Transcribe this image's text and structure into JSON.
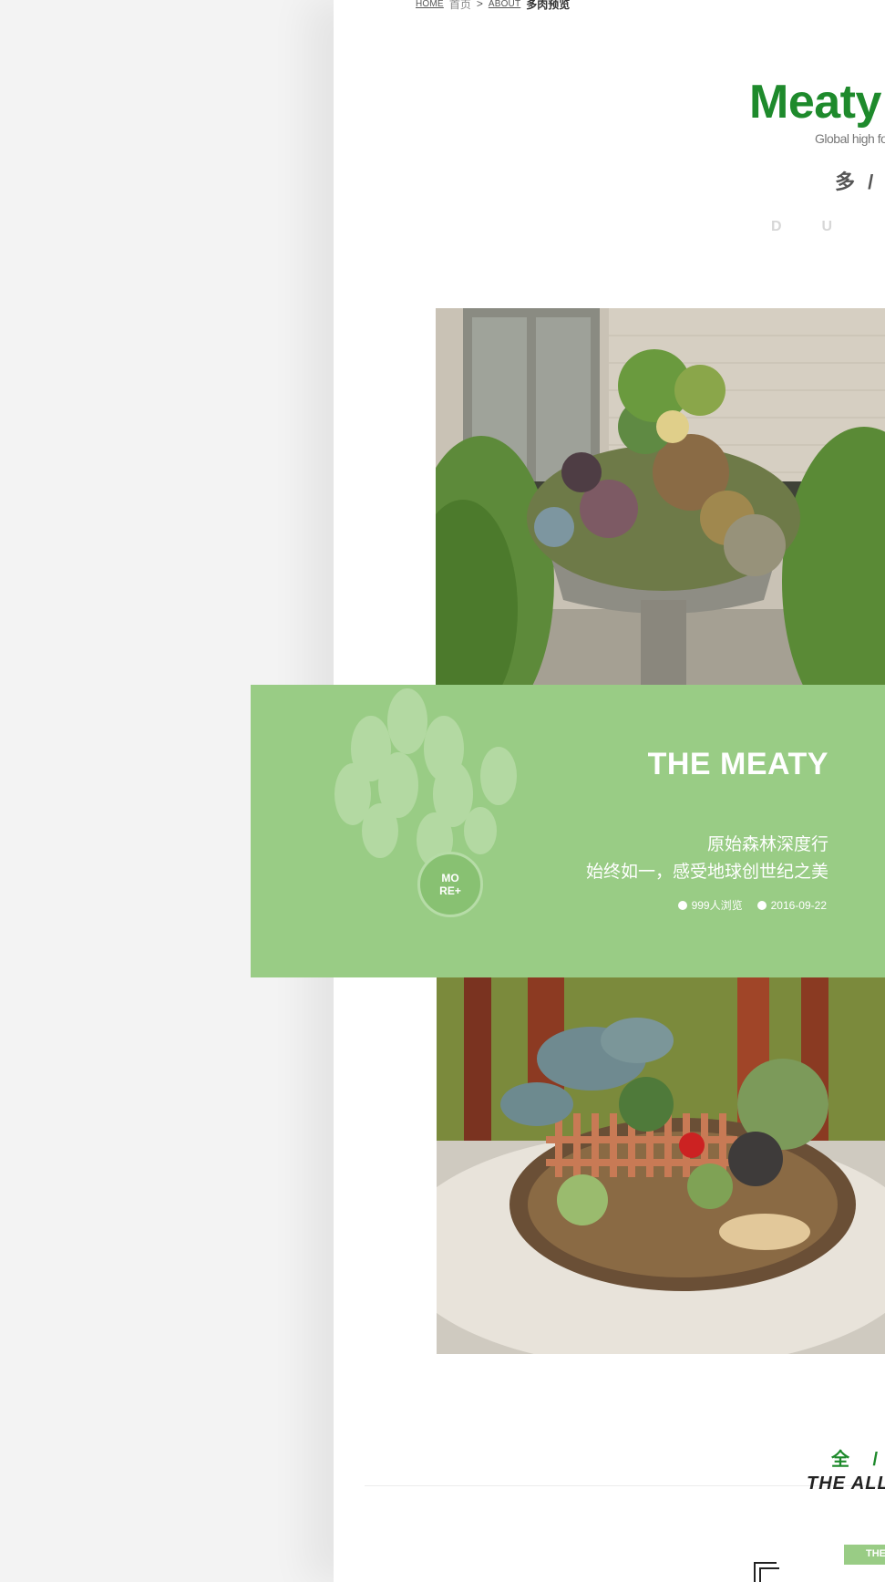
{
  "breadcrumb": {
    "home_en": "HOME",
    "home_cn": "首页",
    "separator": ">",
    "about_en": "ABOUT",
    "current_cn": "多肉预览"
  },
  "header": {
    "title": "Meaty",
    "subtitle_en": "Global high fo",
    "subtitle_cn": "多 / 肉",
    "spaced_letters": "DU"
  },
  "card": {
    "title": "THE MEATY",
    "line1": "原始森林深度行",
    "line2": "始终如一，感受地球创世纪之美",
    "views": "999人浏览",
    "date": "2016-09-22",
    "more_label": "MO\nRE+"
  },
  "section": {
    "title_cn": "全 / 部",
    "title_en": "THE ALL",
    "tag": "THE"
  },
  "colors": {
    "brand_green": "#1e8a2c",
    "card_green": "#99cc85"
  }
}
